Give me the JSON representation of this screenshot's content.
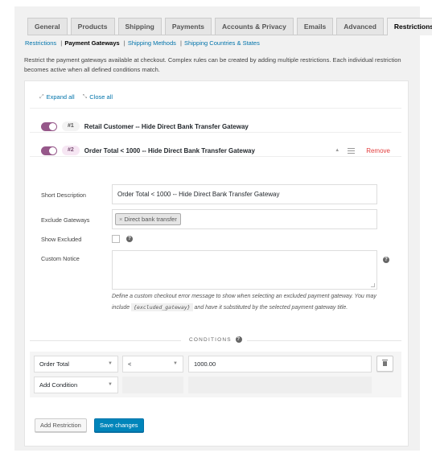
{
  "tabs": [
    {
      "label": "General",
      "active": false
    },
    {
      "label": "Products",
      "active": false
    },
    {
      "label": "Shipping",
      "active": false
    },
    {
      "label": "Payments",
      "active": false
    },
    {
      "label": "Accounts & Privacy",
      "active": false
    },
    {
      "label": "Emails",
      "active": false
    },
    {
      "label": "Advanced",
      "active": false
    },
    {
      "label": "Restrictions",
      "active": true
    }
  ],
  "subnav": {
    "restrictions": "Restrictions",
    "payment_gateways": "Payment Gateways",
    "shipping_methods": "Shipping Methods",
    "shipping_countries": "Shipping Countries & States",
    "separator": "|"
  },
  "description": "Restrict the payment gateways available at checkout. Complex rules can be created by adding multiple restrictions. Each individual restriction becomes active when all defined conditions match.",
  "toolbar": {
    "expand_all": "Expand all",
    "close_all": "Close all"
  },
  "rules": [
    {
      "number": "#1",
      "title": "Retail Customer -- Hide Direct Bank Transfer Gateway",
      "enabled": true
    },
    {
      "number": "#2",
      "title": "Order Total < 1000 -- Hide Direct Bank Transfer Gateway",
      "enabled": true,
      "remove_label": "Remove"
    }
  ],
  "form": {
    "short_description_label": "Short Description",
    "short_description_value": "Order Total < 1000 -- Hide Direct Bank Transfer Gateway",
    "exclude_gateways_label": "Exclude Gateways",
    "exclude_gateways_tags": [
      "Direct bank transfer"
    ],
    "tag_remove_glyph": "×",
    "show_excluded_label": "Show Excluded",
    "show_excluded_checked": false,
    "custom_notice_label": "Custom Notice",
    "custom_notice_value": "",
    "hint_part1": "Define a custom checkout error message to show when selecting an excluded payment gateway. You may include ",
    "hint_code": "{excluded_gateway}",
    "hint_part2": " and have it substituted by the selected payment gateway title.",
    "help_glyph": "?"
  },
  "conditions": {
    "header": "CONDITIONS",
    "rows": [
      {
        "type": "Order Total",
        "operator": "<",
        "value": "1000.00"
      }
    ],
    "add_condition_label": "Add Condition"
  },
  "buttons": {
    "add_restriction": "Add Restriction",
    "save_changes": "Save changes"
  },
  "colors": {
    "toggle_on": "#96588a",
    "link": "#0073aa",
    "remove": "#e23e3e",
    "primary_button": "#0085ba"
  }
}
